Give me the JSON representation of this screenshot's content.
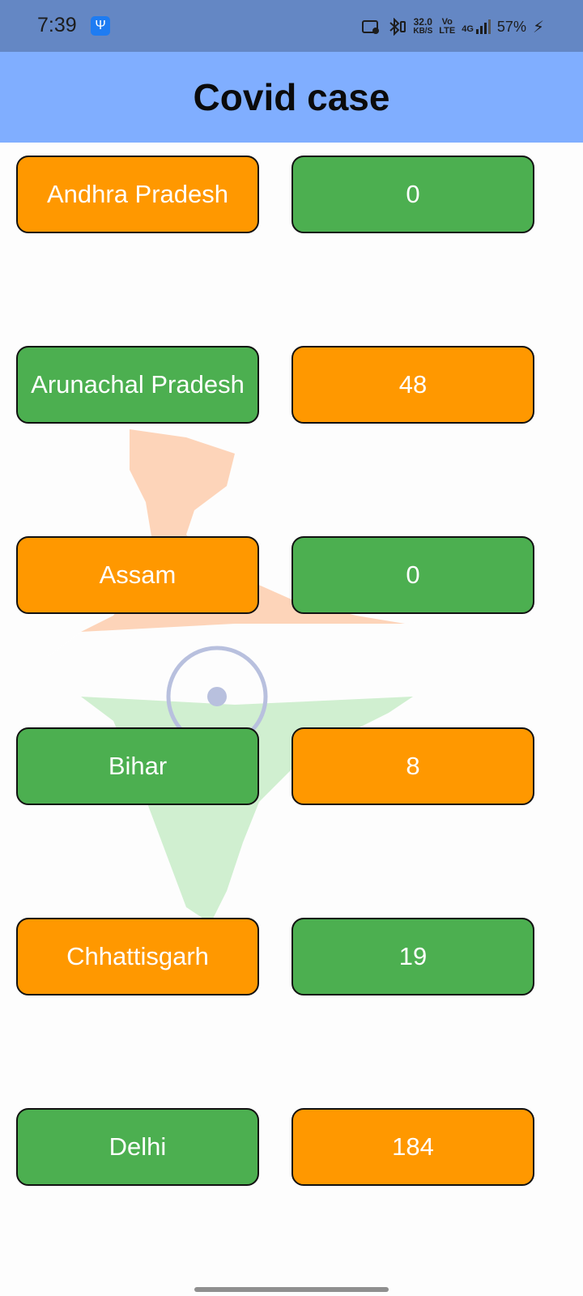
{
  "status_bar": {
    "time": "7:39",
    "usb_icon": "usb-icon",
    "speed_value": "32.0",
    "speed_unit": "KB/S",
    "volte_top": "Vo",
    "volte_bottom": "LTE",
    "network": "4G",
    "battery": "57%"
  },
  "app_bar": {
    "title": "Covid case"
  },
  "rows": [
    {
      "state": "Andhra Pradesh",
      "cases": "0",
      "state_color": "#ff9800",
      "cases_color": "#4caf50"
    },
    {
      "state": "Arunachal Pradesh",
      "cases": "48",
      "state_color": "#4caf50",
      "cases_color": "#ff9800"
    },
    {
      "state": "Assam",
      "cases": "0",
      "state_color": "#ff9800",
      "cases_color": "#4caf50"
    },
    {
      "state": "Bihar",
      "cases": "8",
      "state_color": "#4caf50",
      "cases_color": "#ff9800"
    },
    {
      "state": "Chhattisgarh",
      "cases": "19",
      "state_color": "#ff9800",
      "cases_color": "#4caf50"
    },
    {
      "state": "Delhi",
      "cases": "184",
      "state_color": "#4caf50",
      "cases_color": "#ff9800"
    }
  ],
  "colors": {
    "status_bar": "#6487c4",
    "app_bar": "#80aeff",
    "orange": "#ff9800",
    "green": "#4caf50"
  }
}
